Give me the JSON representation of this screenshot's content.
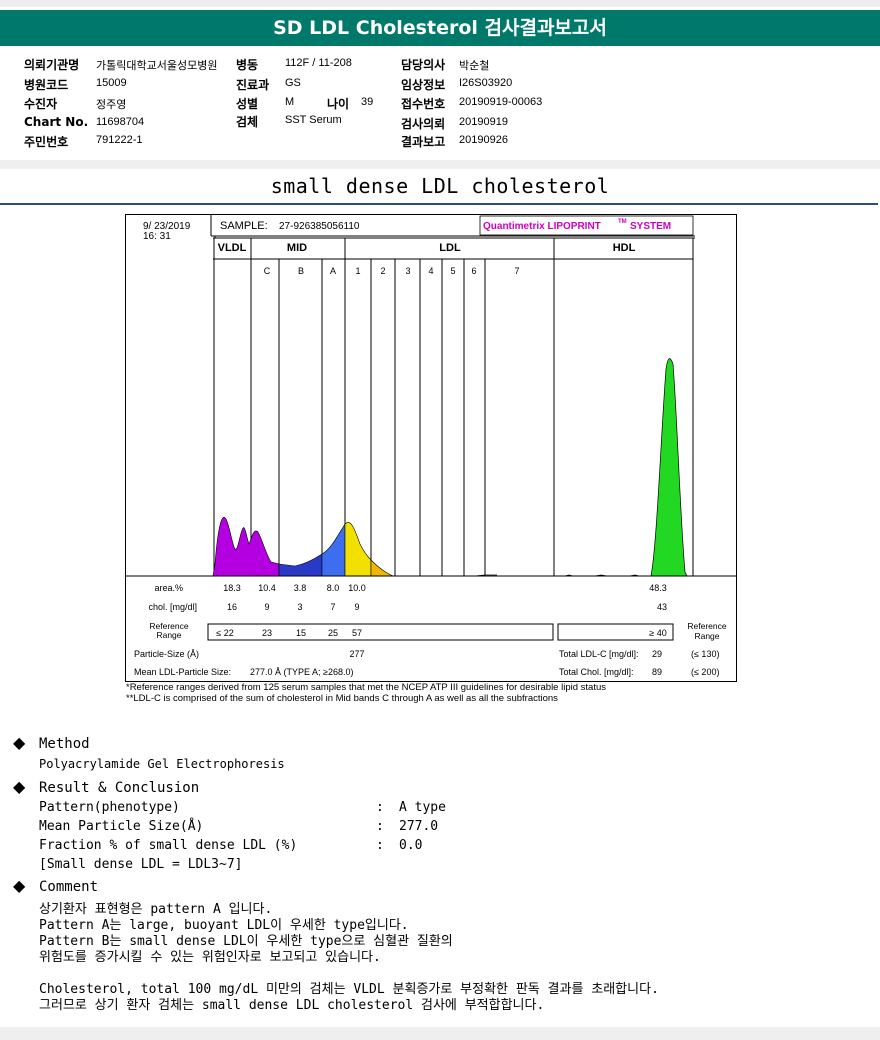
{
  "title": "SD LDL Cholesterol 검사결과보고서",
  "info": {
    "col1": [
      {
        "key": "의뢰기관명",
        "val": "가톨릭대학교서울성모병원"
      },
      {
        "key": "병원코드",
        "val": "15009"
      },
      {
        "key": "수진자",
        "val": "정주영"
      },
      {
        "key": "Chart No.",
        "val": "11698704"
      },
      {
        "key": "주민번호",
        "val": "791222-1"
      }
    ],
    "col2": [
      {
        "key": "병동",
        "val": "112F / 11-208"
      },
      {
        "key": "진료과",
        "val": "GS"
      },
      {
        "key": "성별",
        "val": "M"
      },
      {
        "key": "검체",
        "val": "SST Serum"
      }
    ],
    "age_key": "나이",
    "age_val": "39",
    "col3": [
      {
        "key": "담당의사",
        "val": "박순철"
      },
      {
        "key": "임상정보",
        "val": "I26S03920"
      },
      {
        "key": "접수번호",
        "val": "20190919-00063"
      },
      {
        "key": "검사의뢰",
        "val": "20190919"
      },
      {
        "key": "결과보고",
        "val": "20190926"
      }
    ]
  },
  "section_title": "small dense LDL cholesterol",
  "chart": {
    "date": "9/ 23/2019",
    "time": "16: 31",
    "sample_label": "SAMPLE:",
    "sample_id": "27-926385056110",
    "brand": "Quantimetrix LIPOPRINT",
    "brand_tm": "TM",
    "brand_tail": "SYSTEM",
    "groups": [
      "VLDL",
      "MID",
      "LDL",
      "HDL"
    ],
    "bands": [
      "C",
      "B",
      "A",
      "1",
      "2",
      "3",
      "4",
      "5",
      "6",
      "7"
    ],
    "colors": {
      "vldl": "#b400e0",
      "mid_b": "#2a3ac8",
      "mid_a": "#3d6ef0",
      "ldl1": "#f2e000",
      "ldl2": "#f0b800",
      "hdl": "#22d822"
    },
    "rows": {
      "area_label": "area.%",
      "area_values": [
        "18.3",
        "10.4",
        "3.8",
        "8.0",
        "10.0",
        "48.3"
      ],
      "chol_label": "chol. [mg/dl]",
      "chol_values": [
        "16",
        "9",
        "3",
        "7",
        "9",
        "43"
      ],
      "ref_label_1": "Reference",
      "ref_label_2": "Range",
      "ref_values": [
        "≤ 22",
        "23",
        "15",
        "25",
        "57",
        "≥ 40"
      ],
      "ref_right_1": "Reference",
      "ref_right_2": "Range",
      "ps_label": "Particle-Size (Å)",
      "ps_value": "277",
      "tldl_label": "Total LDL-C [mg/dl]:",
      "tldl_value": "29",
      "tldl_ref": "(≤ 130)",
      "mean_label": "Mean LDL-Particle Size:",
      "mean_value": "277.0 Å  (TYPE A; ≥268.0)",
      "tchol_label": "Total Chol. [mg/dl]:",
      "tchol_value": "89",
      "tchol_ref": "(≤ 200)"
    },
    "foot1": "*Reference ranges derived from 125 serum samples that met the NCEP ATP III guidelines for desirable lipid status",
    "foot2": "**LDL-C is comprised of the sum of cholesterol in Mid bands C through A as well as all the subfractions"
  },
  "method": {
    "heading": "Method",
    "text": "Polyacrylamide Gel Electrophoresis"
  },
  "result": {
    "heading": "Result & Conclusion",
    "rows": [
      {
        "label": "Pattern(phenotype)",
        "colon": ":",
        "value": "A type"
      },
      {
        "label": "Mean Particle Size(Å)",
        "colon": ":",
        "value": "277.0"
      },
      {
        "label": "Fraction % of small dense LDL (%)",
        "colon": ":",
        "value": "0.0"
      }
    ],
    "note": "[Small dense LDL = LDL3~7]"
  },
  "comment": {
    "heading": "Comment",
    "lines": [
      "상기환자 표현형은 pattern A 입니다.",
      "Pattern A는 large, buoyant LDL이 우세한 type입니다.",
      "Pattern B는 small dense LDL이 우세한 type으로 심혈관 질환의",
      "위험도를 증가시킬 수 있는 위험인자로 보고되고 있습니다.",
      "",
      "Cholesterol, total 100 mg/dL 미만의 검체는 VLDL 분획증가로 부정확한 판독 결과를 초래합니다.",
      "그러므로 상기 환자 검체는 small dense LDL cholesterol 검사에 부적합합니다."
    ]
  }
}
